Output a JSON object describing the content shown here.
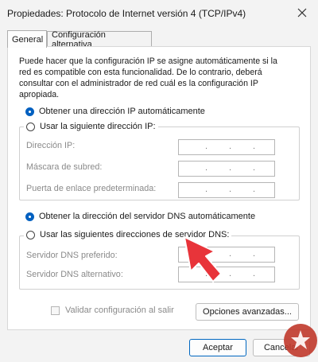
{
  "window": {
    "title": "Propiedades: Protocolo de Internet versión 4 (TCP/IPv4)",
    "close_icon": "close-icon"
  },
  "tabs": [
    {
      "label": "General",
      "active": true
    },
    {
      "label": "Configuración alternativa",
      "active": false
    }
  ],
  "intro": "Puede hacer que la configuración IP se asigne automáticamente si la red es compatible con esta funcionalidad. De lo contrario, deberá consultar con el administrador de red cuál es la configuración IP apropiada.",
  "ip": {
    "auto_label": "Obtener una dirección IP automáticamente",
    "auto_checked": true,
    "manual_label": "Usar la siguiente dirección IP:",
    "manual_checked": false,
    "fields": [
      {
        "label": "Dirección IP:",
        "value": ""
      },
      {
        "label": "Máscara de subred:",
        "value": ""
      },
      {
        "label": "Puerta de enlace predeterminada:",
        "value": ""
      }
    ]
  },
  "dns": {
    "auto_label": "Obtener la dirección del servidor DNS automáticamente",
    "auto_checked": true,
    "manual_label": "Usar las siguientes direcciones de servidor DNS:",
    "manual_checked": false,
    "fields": [
      {
        "label": "Servidor DNS preferido:",
        "value": ""
      },
      {
        "label": "Servidor DNS alternativo:",
        "value": ""
      }
    ]
  },
  "validate_label": "Validar configuración al salir",
  "validate_checked": false,
  "advanced_button": "Opciones avanzadas...",
  "ok_button": "Aceptar",
  "cancel_button": "Cancelar",
  "colors": {
    "accent": "#0060c0",
    "arrow": "#e8343a",
    "logo": "#c0392b"
  }
}
